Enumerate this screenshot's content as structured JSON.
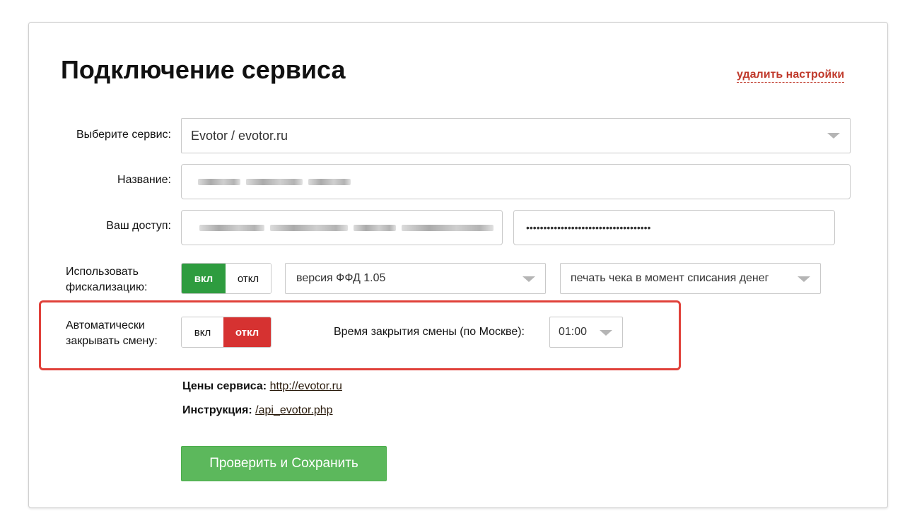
{
  "header": {
    "title": "Подключение сервиса",
    "delete_link": "удалить настройки"
  },
  "form": {
    "service": {
      "label": "Выберите сервис:",
      "value": "Evotor / evotor.ru"
    },
    "name": {
      "label": "Название:"
    },
    "access": {
      "label": "Ваш доступ:",
      "password_mask": "••••••••••••••••••••••••••••••••••••"
    },
    "fiscal": {
      "label_line1": "Использовать",
      "label_line2": "фискализацию:",
      "on": "вкл",
      "off": "откл",
      "state": "on",
      "ffd_version": "версия ФФД 1.05",
      "print_mode": "печать чека в момент списания денег"
    },
    "autoclose": {
      "label_line1": "Автоматически",
      "label_line2": "закрывать смену:",
      "on": "вкл",
      "off": "откл",
      "state": "off",
      "time_label": "Время закрытия смены (по Москве):",
      "time_value": "01:00"
    }
  },
  "info": {
    "prices_label": "Цены сервиса:",
    "prices_link": "http://evotor.ru",
    "instruction_label": "Инструкция:",
    "instruction_link": "/api_evotor.php"
  },
  "actions": {
    "save": "Проверить и Сохранить"
  },
  "colors": {
    "toggle_on": "#2e9c3f",
    "toggle_off_active": "#d63231",
    "save_button": "#5cb85c",
    "highlight": "#e0413a",
    "delete_link": "#c0392b"
  }
}
